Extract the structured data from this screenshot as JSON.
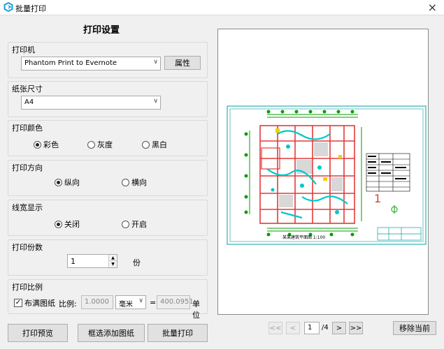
{
  "window": {
    "title": "批量打印",
    "close_glyph": "×",
    "icon": "app-logo-icon",
    "accent_color": "#1e9fd6"
  },
  "settings": {
    "title": "打印设置",
    "printer": {
      "label": "打印机",
      "selected": "Phantom Print to Evernote",
      "properties_label": "属性"
    },
    "paper": {
      "label": "纸张尺寸",
      "selected": "A4"
    },
    "color": {
      "label": "打印颜色",
      "options": [
        "彩色",
        "灰度",
        "黑白"
      ],
      "selected_index": 0
    },
    "orientation": {
      "label": "打印方向",
      "options": [
        "纵向",
        "横向"
      ],
      "selected_index": 0
    },
    "linewidth": {
      "label": "线宽显示",
      "options": [
        "关闭",
        "开启"
      ],
      "selected_index": 0
    },
    "copies": {
      "label": "打印份数",
      "value": "1",
      "unit": "份"
    },
    "scale": {
      "label": "打印比例",
      "fit_label": "布满图纸",
      "fit_checked": true,
      "ratio_label": "比例:",
      "ratio_value": "1.0000",
      "unit_selected": "毫米",
      "equals": "=",
      "drawing_value": "400.0951",
      "drawing_unit_label": "单位"
    }
  },
  "actions": {
    "preview_label": "打印预览",
    "add_drawings_label": "框选添加图纸",
    "batch_print_label": "批量打印"
  },
  "navigation": {
    "first": "<<",
    "prev": "<",
    "current_page": "1",
    "total": "/4",
    "next": ">",
    "last": ">>",
    "remove_current_label": "移除当前"
  },
  "drawing": {
    "caption": "某某建筑平面图 1:100",
    "sheet_number": "1",
    "border_color": "#00a0a0",
    "wall_color": "#e23a3a",
    "grid_color": "#00a000",
    "fixture_color": "#00c8c8"
  }
}
